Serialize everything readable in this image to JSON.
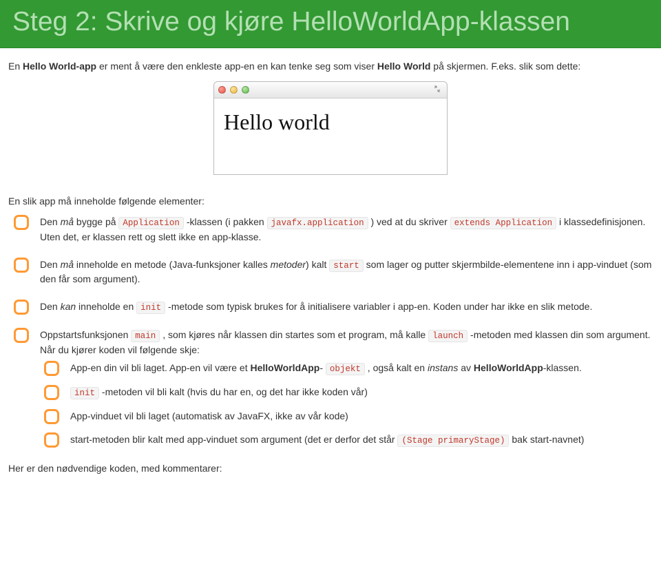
{
  "header": {
    "title": "Steg 2: Skrive og kjøre HelloWorldApp-klassen"
  },
  "intro_before_bold": "En ",
  "intro_bold": "Hello World-app",
  "intro_after_bold": " er ment å være den enkleste app-en en kan tenke seg som viser ",
  "intro_bold2": "Hello World",
  "intro_after_bold2": " på skjermen. F.eks. slik som dette:",
  "mac_window": {
    "body_text": "Hello world"
  },
  "lead": "En slik app må inneholde følgende elementer:",
  "items": [
    {
      "pre": "Den ",
      "em1": "må",
      "mid1": " bygge på ",
      "code1": "Application",
      "mid2": " -klassen (i pakken ",
      "code2": "javafx.application",
      "mid3": " ) ved at du skriver ",
      "code3": "extends Application",
      "mid4": " i klassedefinisjonen. Uten det, er klassen rett og slett ikke en app-klasse."
    },
    {
      "pre": "Den ",
      "em1": "må",
      "mid1": " inneholde en metode (Java-funksjoner kalles ",
      "em2": "metoder",
      "mid2": ") kalt ",
      "code1": "start",
      "mid3": " som lager og putter skjermbilde-elementene inn i app-vinduet (som den får som argument)."
    },
    {
      "pre": "Den ",
      "em1": "kan",
      "mid1": " inneholde en ",
      "code1": "init",
      "mid2": " -metode som typisk brukes for å initialisere variabler i app-en. Koden under har ikke en slik metode."
    },
    {
      "pre": "Oppstartsfunksjonen ",
      "code1": "main",
      "mid1": " , som kjøres når klassen din startes som et program, må kalle ",
      "code2": "launch",
      "mid2": " -metoden med klassen din som argument. Når du kjører koden vil følgende skje:"
    }
  ],
  "sub_items": [
    {
      "pre": "App-en din vil bli laget. App-en vil være et ",
      "strong1": "HelloWorldApp",
      "mid1": "- ",
      "code1": "objekt",
      "mid2": " , også kalt en ",
      "em1": "instans",
      "mid3": " av ",
      "strong2": "HelloWorldApp",
      "tail": "-klassen."
    },
    {
      "code1": "init",
      "mid1": " -metoden vil bli kalt (hvis du har en, og det har ikke koden vår)"
    },
    {
      "text": "App-vinduet vil bli laget (automatisk av JavaFX, ikke av vår kode)"
    },
    {
      "pre": "start-metoden blir kalt med app-vinduet som argument (det er derfor det står ",
      "code1": "(Stage primaryStage)",
      "mid1": " bak start-navnet)"
    }
  ],
  "outro": "Her er den nødvendige koden, med kommentarer:"
}
